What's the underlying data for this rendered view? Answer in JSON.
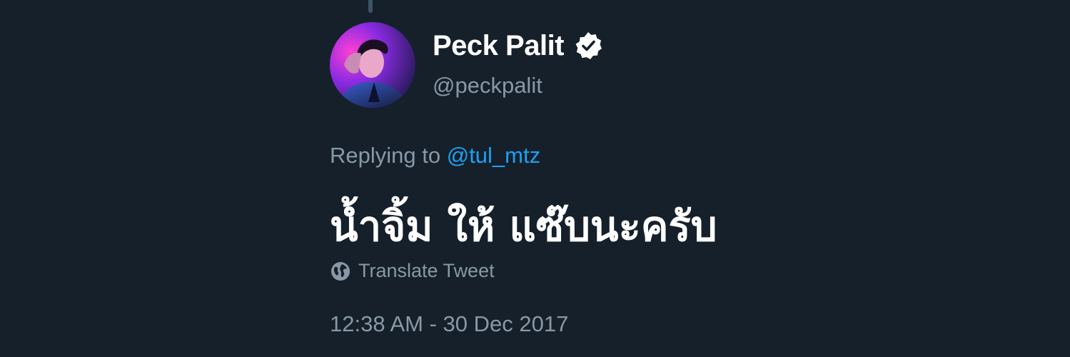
{
  "tweet": {
    "author": {
      "display_name": "Peck Palit",
      "handle": "@peckpalit",
      "verified": true,
      "avatar_icon": "avatar-photo"
    },
    "reply": {
      "prefix": "Replying to",
      "mention": "@tul_mtz"
    },
    "text": "น้ำจิ้ม ให้ แซ๊บนะครับ",
    "translate_label": "Translate Tweet",
    "translate_icon": "globe-icon",
    "timestamp": "12:38 AM - 30 Dec 2017"
  },
  "colors": {
    "background": "#15202b",
    "primary_text": "#ffffff",
    "secondary_text": "#8899a6",
    "link": "#1da1f2"
  }
}
